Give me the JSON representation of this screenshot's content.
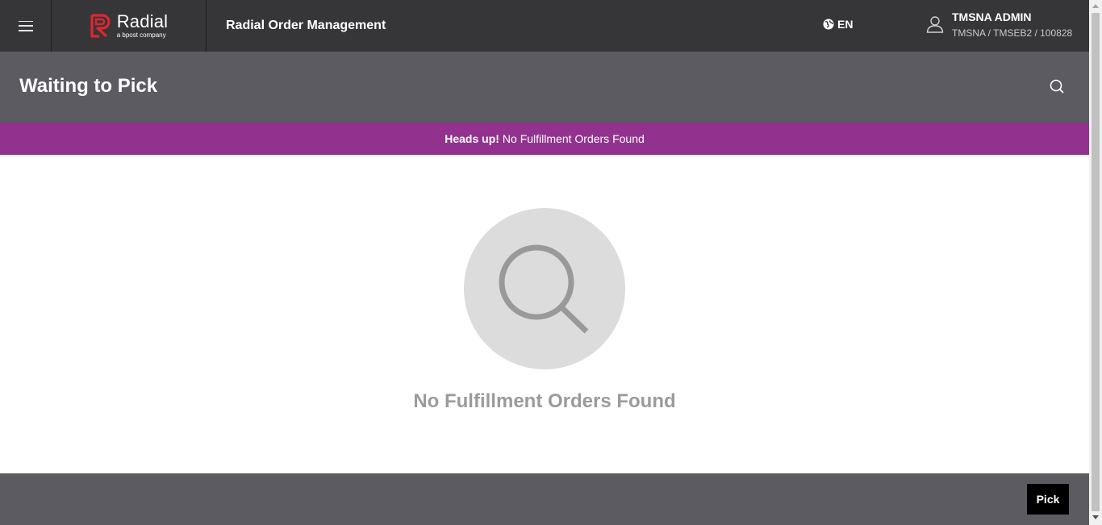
{
  "topbar": {
    "brand_name": "Radial",
    "brand_tagline": "a bpost company",
    "app_title": "Radial Order Management",
    "language": "EN",
    "user_name": "TMSNA ADMIN",
    "user_context": "TMSNA / TMSEB2 / 100828"
  },
  "page": {
    "title": "Waiting to Pick"
  },
  "alert": {
    "strong": "Heads up!",
    "message": "No Fulfillment Orders Found"
  },
  "empty_state": {
    "message": "No Fulfillment Orders Found"
  },
  "footer": {
    "pick_label": "Pick"
  },
  "colors": {
    "topbar": "#363638",
    "header": "#5b5b61",
    "alert": "#93328e",
    "brand_red": "#e0262f"
  },
  "icons": [
    "menu-icon",
    "radial-logo-icon",
    "globe-icon",
    "user-icon",
    "search-icon",
    "empty-search-icon"
  ]
}
